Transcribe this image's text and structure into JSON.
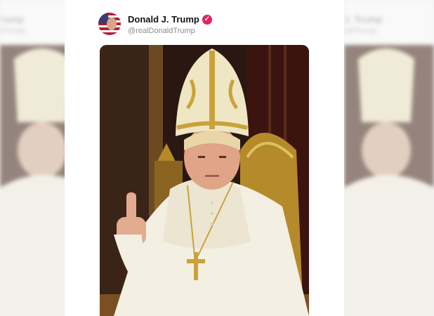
{
  "post": {
    "display_name": "Donald J. Trump",
    "handle": "@realDonaldTrump",
    "verified_icon": "verified-badge-icon",
    "image": "ai-generated-portrait-pope-attire"
  },
  "side_ghost": {
    "name": "J. Trump",
    "handle": "aldTrump"
  },
  "colors": {
    "verified": "#e0245e",
    "miter": "#efe6c4",
    "gold": "#c9a23a",
    "robe": "#f3efe2",
    "background_dark": "#2a1712"
  }
}
